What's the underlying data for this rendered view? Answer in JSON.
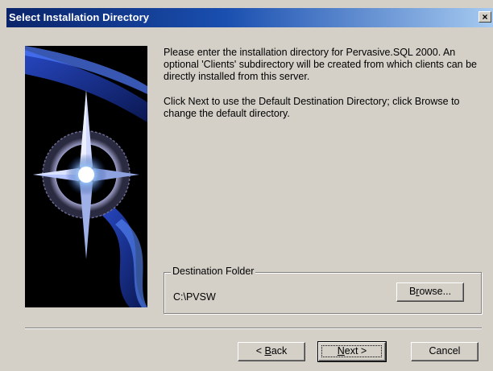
{
  "window": {
    "title": "Select Installation Directory",
    "close_glyph": "×"
  },
  "body": {
    "paragraph1": "Please enter the installation directory for Pervasive.SQL 2000. An optional 'Clients' subdirectory will be created from which clients can be directly installed from this server.",
    "paragraph2": "Click Next to use the Default Destination Directory; click Browse to change the default directory."
  },
  "destination": {
    "label": "Destination Folder",
    "path": "C:\\PVSW",
    "browse_pre": "B",
    "browse_ul": "r",
    "browse_post": "owse..."
  },
  "buttons": {
    "back_pre": "< ",
    "back_ul": "B",
    "back_post": "ack",
    "next_ul": "N",
    "next_post": "ext >",
    "cancel": "Cancel"
  },
  "colors": {
    "title_start": "#0a246a",
    "title_end": "#a6caf0",
    "face": "#d4d0c8"
  },
  "icons": {
    "side_image": "compass-star-icon",
    "close": "close-icon"
  }
}
